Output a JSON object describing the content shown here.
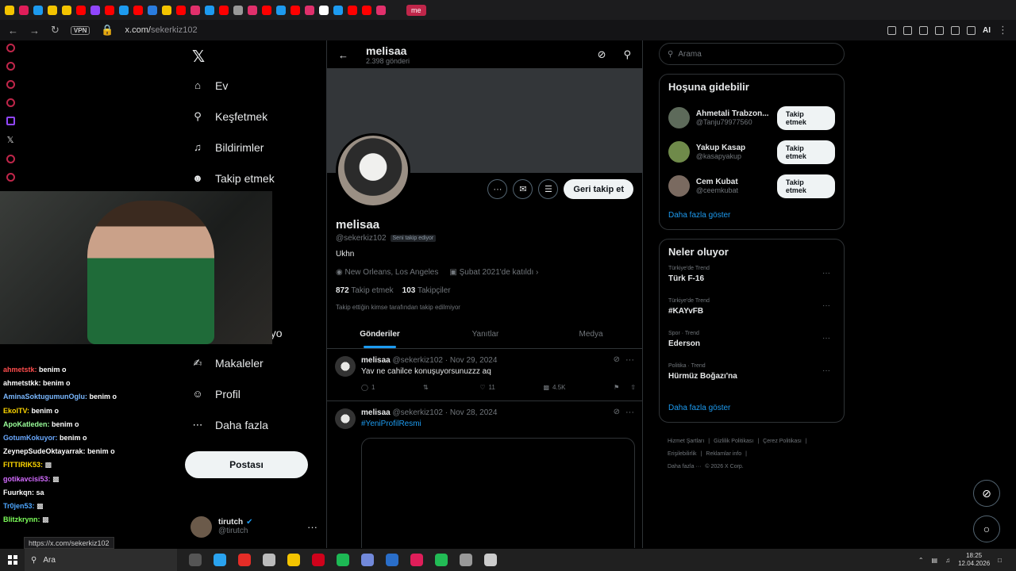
{
  "browser": {
    "url_host": "x.com/",
    "url_path": "sekerkiz102",
    "vpn_label": "VPN",
    "ai_label": "AI",
    "tab_me_label": "me",
    "status_url": "https://x.com/sekerkiz102",
    "tab_colors": [
      "#f4c400",
      "#e01e5a",
      "#1d9bf0",
      "#f4c400",
      "#f4c400",
      "#ff0000",
      "#9146ff",
      "#ff0000",
      "#1d9bf0",
      "#ff0000",
      "#2a7de1",
      "#f4c400",
      "#ff0000",
      "#e1306c",
      "#1d9bf0",
      "#ff0000",
      "#999999",
      "#e1306c",
      "#ff0000",
      "#1d9bf0",
      "#ff0000",
      "#e1306c",
      "#ffffff",
      "#1d9bf0",
      "#ff0000",
      "#ff0000",
      "#e1306c"
    ]
  },
  "nav": {
    "items": [
      {
        "label": "Ev",
        "icon": "home-icon"
      },
      {
        "label": "Keşfetmek",
        "icon": "search-icon"
      },
      {
        "label": "Bildirimler",
        "icon": "bell-icon"
      },
      {
        "label": "Takip etmek",
        "icon": "add-user-icon"
      },
      {
        "label": "dyo",
        "icon": ""
      },
      {
        "label": "Makaleler",
        "icon": "article-icon"
      },
      {
        "label": "Profil",
        "icon": "user-icon"
      },
      {
        "label": "Daha fazla",
        "icon": "more-circle-icon"
      }
    ],
    "post_button": "Postası",
    "account_name": "tirutch",
    "account_handle": "@tirutch"
  },
  "chat": [
    {
      "user": "ahmetstk:",
      "msg": "benim o",
      "color": "#ff4d4d"
    },
    {
      "user": "ahmetstkk:",
      "msg": "benim o",
      "color": "#ffffff"
    },
    {
      "user": "AminaSoktugumunOglu:",
      "msg": "benim o",
      "color": "#7ab8ff"
    },
    {
      "user": "EkolTV:",
      "msg": "benim o",
      "color": "#ffd700"
    },
    {
      "user": "ApoKatleden:",
      "msg": "benim o",
      "color": "#9aff9a"
    },
    {
      "user": "GotumKokuyor:",
      "msg": "benim o",
      "color": "#6aa9ff"
    },
    {
      "user": "ZeynepSudeOktayarrak:",
      "msg": "benim o",
      "color": "#ffffff"
    },
    {
      "user": "FITTIRIK53:",
      "msg": "▩",
      "color": "#ffd700"
    },
    {
      "user": "gotikavcisi53:",
      "msg": "▩",
      "color": "#d36bff"
    },
    {
      "user": "Fuurkqn:",
      "msg": "sa",
      "color": "#ffffff"
    },
    {
      "user": "Tr0jen53:",
      "msg": "▩",
      "color": "#4da6ff"
    },
    {
      "user": "Blitzkrynn:",
      "msg": "▩",
      "color": "#7dff5a"
    }
  ],
  "profile": {
    "header_name": "melisaa",
    "post_count": "2.398 gönderi",
    "name": "melisaa",
    "handle": "@sekerkiz102",
    "follows_you": "Seni takip ediyor",
    "bio": "Ukhn",
    "location": "New Orleans, Los Angeles",
    "joined": "Şubat 2021'de katıldı",
    "following_count": "872",
    "following_label": "Takip etmek",
    "followers_count": "103",
    "followers_label": "Takipçiler",
    "note": "Takip ettiğin kimse tarafından takip edilmiyor",
    "follow_back": "Geri takip et",
    "tabs": [
      "Gönderiler",
      "Yanıtlar",
      "Medya"
    ]
  },
  "posts": [
    {
      "name": "melisaa",
      "handle": "@sekerkiz102",
      "date": "· Nov 29, 2024",
      "text": "Yav ne cahilce konuşuyorsunuzzz aq",
      "replies": "1",
      "reposts": "",
      "likes": "11",
      "views": "4.5K"
    },
    {
      "name": "melisaa",
      "handle": "@sekerkiz102",
      "date": "· Nov 28, 2024",
      "hashtag": "#YeniProfilResmi"
    }
  ],
  "right": {
    "search_placeholder": "Arama",
    "wtf_title": "Hoşuna gidebilir",
    "wtf": [
      {
        "name": "Ahmetali Trabzon...",
        "handle": "@Tanju79977560",
        "btn": "Takip etmek",
        "color": "#5d6a5a"
      },
      {
        "name": "Yakup Kasap",
        "handle": "@kasapyakup",
        "btn": "Takip etmek",
        "color": "#6f8a4a"
      },
      {
        "name": "Cem Kubat",
        "handle": "@ceemkubat",
        "btn": "Takip etmek",
        "color": "#7a6a60"
      }
    ],
    "wtf_more": "Daha fazla göster",
    "trends_title": "Neler oluyor",
    "trends": [
      {
        "context": "Türkiye'de Trend",
        "name": "Türk F-16"
      },
      {
        "context": "Türkiye'de Trend",
        "name": "#KAYvFB"
      },
      {
        "context": "Spor · Trend",
        "name": "Ederson"
      },
      {
        "context": "Politika · Trend",
        "name": "Hürmüz Boğazı'na"
      }
    ],
    "trends_more": "Daha fazla göster",
    "footer": [
      "Hizmet Şartları",
      "|",
      "Gizlilik Politikası",
      "|",
      "Çerez Politikası",
      "|",
      "Erişilebilirlik",
      "|",
      "Reklamlar info",
      "|",
      "Daha fazla ···",
      "© 2026 X Corp."
    ]
  },
  "taskbar": {
    "search": "Ara",
    "time": "18:25",
    "date": "12.04.2026",
    "apps": [
      "#555",
      "#2aa3ef",
      "#e52d27",
      "#bbb",
      "#f4c400",
      "#d0021b",
      "#1db954",
      "#7289da",
      "#2a6ec9",
      "#e01e5a",
      "#22bb55",
      "#999",
      "#ccc"
    ]
  }
}
